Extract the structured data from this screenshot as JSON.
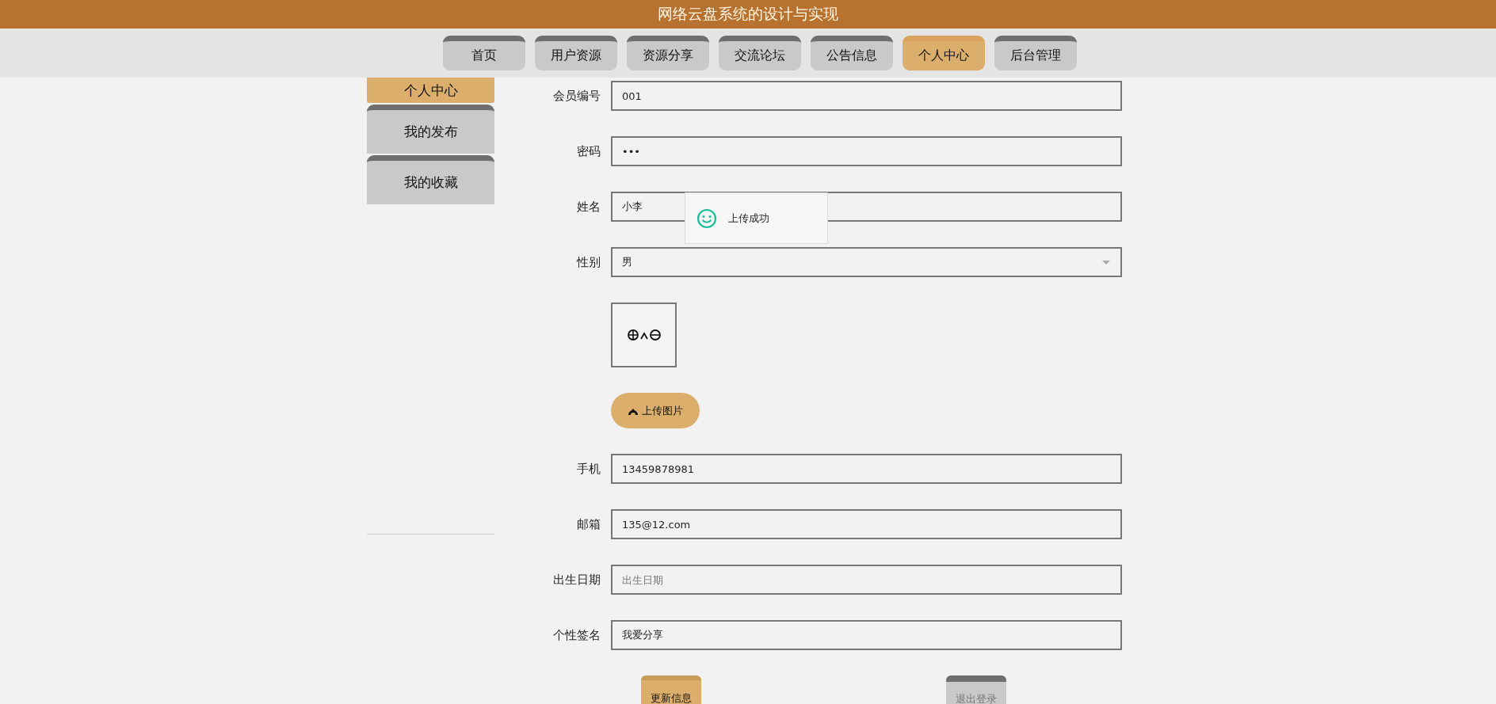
{
  "header": {
    "title": "网络云盘系统的设计与实现"
  },
  "nav": {
    "tabs": [
      {
        "label": "首页",
        "selected": false
      },
      {
        "label": "用户资源",
        "selected": false
      },
      {
        "label": "资源分享",
        "selected": false
      },
      {
        "label": "交流论坛",
        "selected": false
      },
      {
        "label": "公告信息",
        "selected": false
      },
      {
        "label": "个人中心",
        "selected": true
      },
      {
        "label": "后台管理",
        "selected": false
      }
    ]
  },
  "sidebar": {
    "items": [
      {
        "label": "个人中心",
        "selected": true
      },
      {
        "label": "我的发布",
        "selected": false
      },
      {
        "label": "我的收藏",
        "selected": false
      }
    ]
  },
  "form": {
    "fields": [
      {
        "kind": "text",
        "label": "会员编号",
        "value": "001"
      },
      {
        "kind": "text",
        "label": "密码",
        "value": "•••"
      },
      {
        "kind": "text",
        "label": "姓名",
        "value": "小李"
      },
      {
        "kind": "select",
        "label": "性别",
        "value": "男"
      },
      {
        "kind": "avatar"
      },
      {
        "kind": "upload",
        "button": "上传图片"
      },
      {
        "kind": "text",
        "label": "手机",
        "value": "13459878981"
      },
      {
        "kind": "text",
        "label": "邮箱",
        "value": "135@12.com"
      },
      {
        "kind": "text",
        "label": "出生日期",
        "placeholder": "出生日期"
      },
      {
        "kind": "text",
        "label": "个性签名",
        "value": "我爱分享"
      }
    ],
    "buttons": [
      {
        "label": "更新信息",
        "kind": "primary"
      },
      {
        "label": "退出登录",
        "kind": "secondary"
      }
    ]
  },
  "toast": {
    "message": "上传成功"
  }
}
